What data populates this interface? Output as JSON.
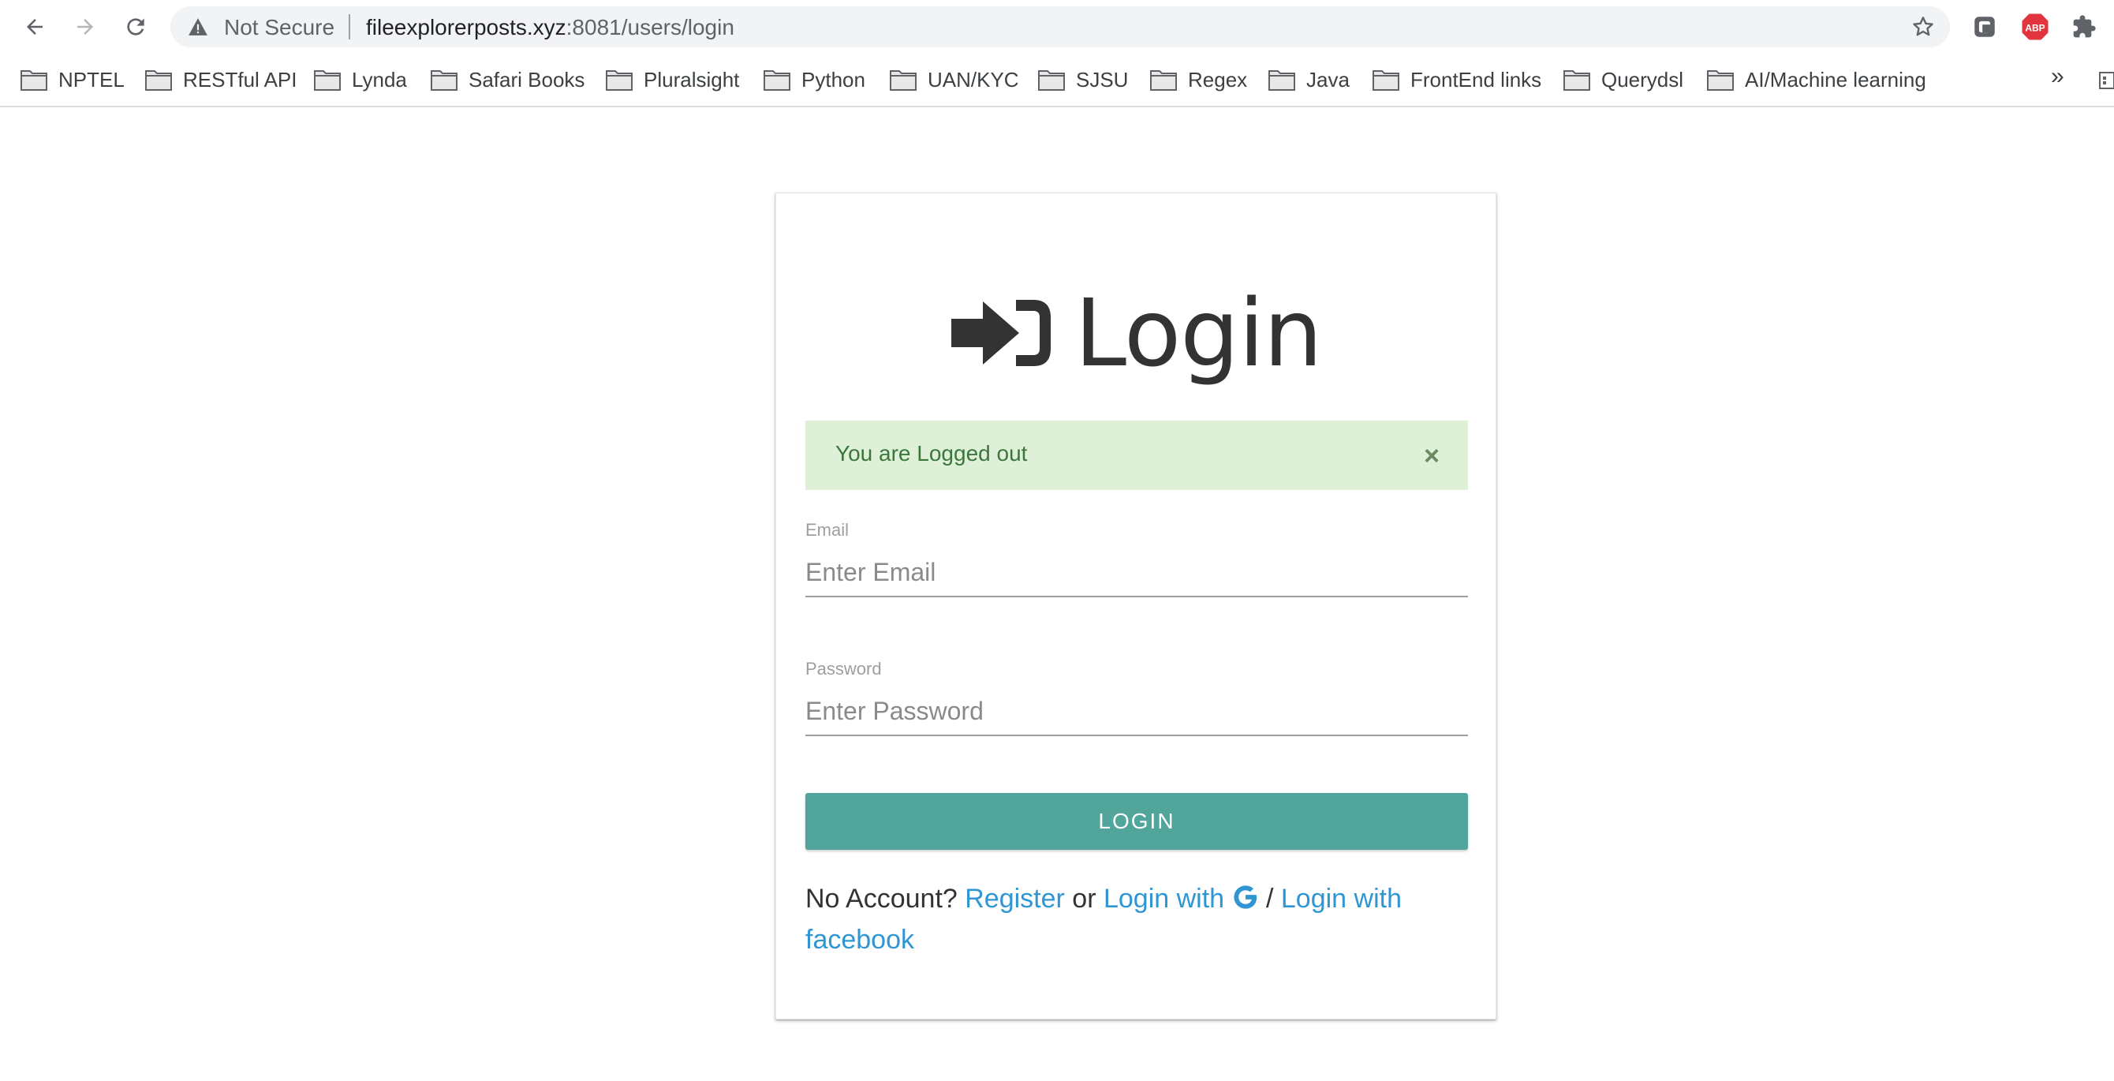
{
  "browser": {
    "security_label": "Not Secure",
    "url_host": "fileexplorerposts.xyz",
    "url_path": ":8081/users/login",
    "extensions": [
      "extension-puzzle-icon",
      "adblock-icon",
      "extension-icon"
    ],
    "adblock_label": "ABP"
  },
  "bookmarks": {
    "items": [
      "NPTEL",
      "RESTful API",
      "Lynda",
      "Safari Books",
      "Pluralsight",
      "Python",
      "UAN/KYC",
      "SJSU",
      "Regex",
      "Java",
      "FrontEnd links",
      "Querydsl",
      "AI/Machine learning"
    ],
    "more_label": "»"
  },
  "login": {
    "title": "Login",
    "alert_text": "You are Logged out",
    "alert_close": "×",
    "email_label": "Email",
    "email_placeholder": "Enter Email",
    "password_label": "Password",
    "password_placeholder": "Enter Password",
    "button_label": "LOGIN",
    "footer": {
      "prefix": "No Account? ",
      "register": "Register",
      "or": " or ",
      "login_google": "Login with ",
      "slash": " / ",
      "login_facebook": "Login with facebook"
    }
  },
  "colors": {
    "accent_button": "#52a59a",
    "link": "#2f96d3",
    "alert_bg": "#dff0d8",
    "alert_text": "#3c763d"
  }
}
